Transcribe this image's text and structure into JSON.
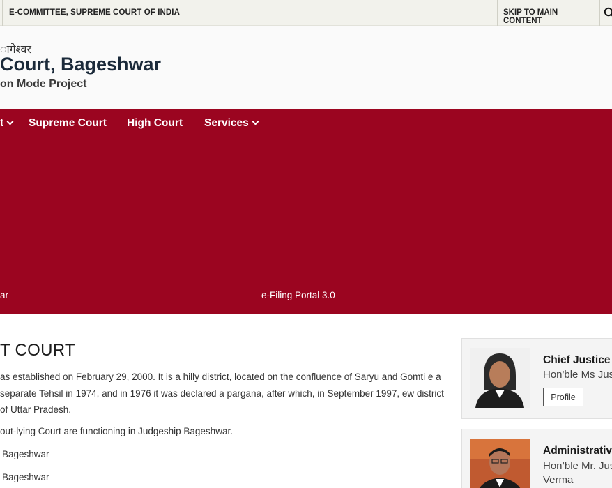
{
  "topbar": {
    "brand": "E-COMMITTEE, SUPREME COURT OF INDIA",
    "skip": "SKIP TO MAIN CONTENT"
  },
  "header": {
    "hindi": "ागेश्वर",
    "court": "Court, Bageshwar",
    "project": "on Mode Project"
  },
  "nav": {
    "items": [
      {
        "label": "t",
        "has_dropdown": true
      },
      {
        "label": "Supreme Court",
        "has_dropdown": false
      },
      {
        "label": "High Court",
        "has_dropdown": false
      },
      {
        "label": "Services",
        "has_dropdown": true
      }
    ]
  },
  "banner": {
    "links": [
      "ar",
      "e-Filing Portal 3.0"
    ]
  },
  "content": {
    "heading": "T COURT",
    "paragraph": "as established on February 29, 2000. It is a hilly district, located on the confluence of Saryu and Gomti e a separate Tehsil in 1974, and in 1976 it was declared a pargana, after which, in September 1997, ew district of Uttar Pradesh.",
    "line1": "out-lying Court are functioning in Judgeship Bageshwar.",
    "line2": "Bageshwar",
    "line3": "Bageshwar"
  },
  "cards": [
    {
      "title": "Chief Justice",
      "name": "Hon'ble Ms Jus",
      "button": "Profile"
    },
    {
      "title": "Administrativ",
      "name": "Hon’ble Mr. Jus",
      "name2": "Verma"
    }
  ],
  "colors": {
    "banner": "#9b0520",
    "topbar": "#f2f2ec"
  }
}
